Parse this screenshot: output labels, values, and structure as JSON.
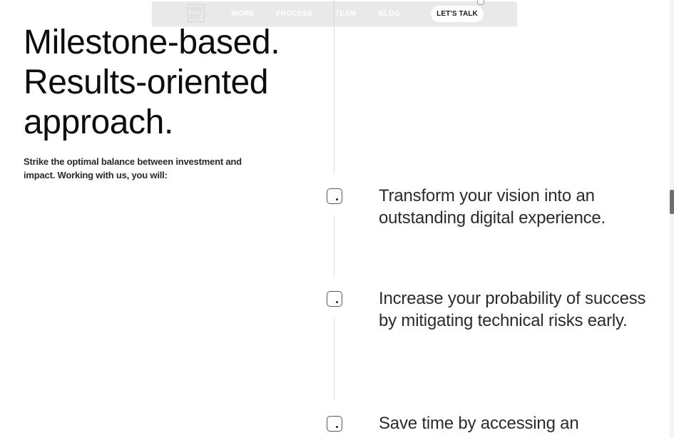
{
  "nav": {
    "logo_line1": "PUR",
    "logo_line2": "DEC",
    "links": [
      "WORK",
      "PROCESS",
      "TEAM",
      "BLOG"
    ],
    "cta": "LET'S TALK"
  },
  "hero": {
    "title_lines": [
      "Milestone-based.",
      "Results-oriented",
      "approach."
    ],
    "subtitle": "Strike the optimal balance between investment and impact. Working with us, you will:"
  },
  "benefits": [
    {
      "text": "Transform your vision into an outstanding digital experience.",
      "icon": "checkbox-icon"
    },
    {
      "text": "Increase your probability of success by mitigating technical risks early.",
      "icon": "checkbox-icon"
    },
    {
      "text": "Save time by accessing an",
      "icon": "checkbox-icon"
    }
  ],
  "colors": {
    "nav_background": "#e9e9e9",
    "text_primary": "#0d0d0d",
    "timeline_line": "#d9d9d9"
  }
}
